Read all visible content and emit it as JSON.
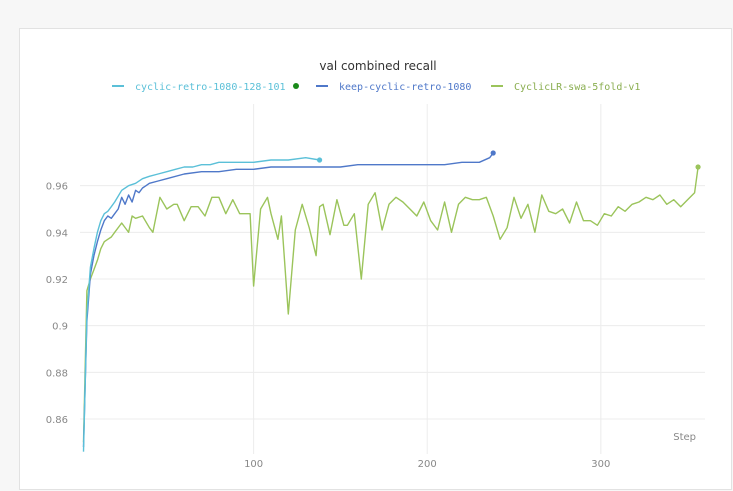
{
  "chart_data": {
    "type": "line",
    "title": "val combined recall",
    "xlabel": "Step",
    "ylabel": "",
    "xlim": [
      0,
      360
    ],
    "ylim": [
      0.845,
      0.995
    ],
    "xticks": [
      100,
      200,
      300
    ],
    "yticks": [
      0.86,
      0.88,
      0.9,
      0.92,
      0.94,
      0.96
    ],
    "ytick_labels": [
      "0.86",
      "0.88",
      "0.9",
      "0.92",
      "0.94",
      "0.96"
    ],
    "grid": true,
    "legend_position": "top",
    "series": [
      {
        "name": "cyclic-retro-1080-128-101",
        "color": "#5bc0d8",
        "marker_color": "#1a8a1a",
        "x": [
          2,
          4,
          6,
          8,
          10,
          12,
          14,
          16,
          18,
          20,
          24,
          28,
          32,
          36,
          40,
          45,
          50,
          55,
          60,
          65,
          70,
          75,
          80,
          90,
          100,
          110,
          120,
          130,
          138
        ],
        "y": [
          0.846,
          0.905,
          0.925,
          0.933,
          0.94,
          0.945,
          0.948,
          0.949,
          0.951,
          0.953,
          0.958,
          0.96,
          0.961,
          0.963,
          0.964,
          0.965,
          0.966,
          0.967,
          0.968,
          0.968,
          0.969,
          0.969,
          0.97,
          0.97,
          0.97,
          0.971,
          0.971,
          0.972,
          0.971
        ]
      },
      {
        "name": "keep-cyclic-retro-1080",
        "color": "#4f78c9",
        "x": [
          2,
          4,
          6,
          8,
          10,
          12,
          14,
          16,
          18,
          20,
          22,
          24,
          26,
          28,
          30,
          32,
          34,
          36,
          38,
          40,
          45,
          50,
          60,
          70,
          80,
          90,
          100,
          110,
          120,
          130,
          140,
          150,
          160,
          170,
          180,
          190,
          200,
          210,
          220,
          230,
          236,
          238
        ],
        "y": [
          0.848,
          0.902,
          0.922,
          0.93,
          0.936,
          0.941,
          0.945,
          0.947,
          0.946,
          0.948,
          0.95,
          0.955,
          0.952,
          0.956,
          0.953,
          0.958,
          0.957,
          0.959,
          0.96,
          0.961,
          0.962,
          0.963,
          0.965,
          0.966,
          0.966,
          0.967,
          0.967,
          0.968,
          0.968,
          0.968,
          0.968,
          0.968,
          0.969,
          0.969,
          0.969,
          0.969,
          0.969,
          0.969,
          0.97,
          0.97,
          0.972,
          0.974
        ]
      },
      {
        "name": "CyclicLR-swa-5fold-v1",
        "color": "#9bc45b",
        "x": [
          2,
          4,
          6,
          8,
          10,
          12,
          14,
          16,
          18,
          20,
          24,
          28,
          30,
          32,
          36,
          40,
          42,
          46,
          50,
          54,
          56,
          60,
          64,
          68,
          72,
          76,
          80,
          84,
          88,
          92,
          96,
          98,
          100,
          104,
          108,
          110,
          114,
          116,
          120,
          124,
          128,
          132,
          136,
          138,
          140,
          144,
          148,
          152,
          154,
          158,
          162,
          166,
          170,
          174,
          178,
          182,
          186,
          190,
          194,
          198,
          202,
          206,
          210,
          214,
          218,
          222,
          226,
          230,
          234,
          238,
          242,
          246,
          250,
          254,
          258,
          262,
          266,
          270,
          274,
          278,
          282,
          286,
          290,
          294,
          298,
          302,
          306,
          310,
          314,
          318,
          322,
          326,
          330,
          334,
          338,
          342,
          346,
          350,
          354,
          356
        ],
        "y": [
          0.85,
          0.915,
          0.92,
          0.924,
          0.928,
          0.933,
          0.936,
          0.937,
          0.938,
          0.94,
          0.944,
          0.94,
          0.947,
          0.946,
          0.947,
          0.942,
          0.94,
          0.955,
          0.95,
          0.952,
          0.952,
          0.945,
          0.951,
          0.951,
          0.947,
          0.955,
          0.955,
          0.948,
          0.954,
          0.948,
          0.948,
          0.948,
          0.917,
          0.95,
          0.955,
          0.948,
          0.937,
          0.947,
          0.905,
          0.941,
          0.952,
          0.942,
          0.93,
          0.951,
          0.952,
          0.939,
          0.954,
          0.943,
          0.943,
          0.948,
          0.92,
          0.952,
          0.957,
          0.941,
          0.952,
          0.955,
          0.953,
          0.95,
          0.947,
          0.953,
          0.945,
          0.941,
          0.953,
          0.94,
          0.952,
          0.955,
          0.954,
          0.954,
          0.955,
          0.947,
          0.937,
          0.942,
          0.955,
          0.946,
          0.952,
          0.94,
          0.956,
          0.949,
          0.948,
          0.95,
          0.944,
          0.953,
          0.945,
          0.945,
          0.943,
          0.948,
          0.947,
          0.951,
          0.949,
          0.952,
          0.953,
          0.955,
          0.954,
          0.956,
          0.952,
          0.954,
          0.951,
          0.954,
          0.957,
          0.968
        ]
      }
    ]
  }
}
